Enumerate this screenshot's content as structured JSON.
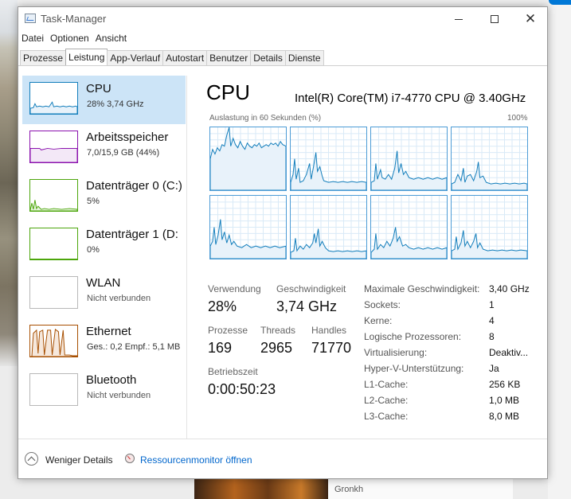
{
  "window": {
    "title": "Task-Manager"
  },
  "menu": [
    "Datei",
    "Optionen",
    "Ansicht"
  ],
  "tabs": [
    "Prozesse",
    "Leistung",
    "App-Verlauf",
    "Autostart",
    "Benutzer",
    "Details",
    "Dienste"
  ],
  "active_tab": "Leistung",
  "resources": [
    {
      "name": "CPU",
      "sub": "28%  3,74 GHz",
      "color": "#117dbb",
      "selected": true
    },
    {
      "name": "Arbeitsspeicher",
      "sub": "7,0/15,9 GB (44%)",
      "color": "#8b12ae",
      "selected": false
    },
    {
      "name": "Datenträger 0 (C:)",
      "sub": "5%",
      "color": "#4da60c",
      "selected": false
    },
    {
      "name": "Datenträger 1 (D:",
      "sub": "0%",
      "color": "#4da60c",
      "selected": false
    },
    {
      "name": "WLAN",
      "sub": "Nicht verbunden",
      "color": "#a0a0a0",
      "selected": false
    },
    {
      "name": "Ethernet",
      "sub": "Ges.: 0,2  Empf.: 5,1 MB",
      "color": "#a74f01",
      "selected": false
    },
    {
      "name": "Bluetooth",
      "sub": "Nicht verbunden",
      "color": "#a0a0a0",
      "selected": false
    }
  ],
  "cpu": {
    "title": "CPU",
    "model": "Intel(R) Core(TM) i7-4770 CPU @ 3.40GHz",
    "util_label": "Auslastung in 60 Sekunden (%)",
    "util_max": "100%",
    "stats": {
      "verwendung_label": "Verwendung",
      "verwendung": "28%",
      "geschwindigkeit_label": "Geschwindigkeit",
      "geschwindigkeit": "3,74 GHz",
      "prozesse_label": "Prozesse",
      "prozesse": "169",
      "threads_label": "Threads",
      "threads": "2965",
      "handles_label": "Handles",
      "handles": "71770",
      "betriebszeit_label": "Betriebszeit",
      "betriebszeit": "0:00:50:23"
    },
    "info": [
      {
        "key": "Maximale Geschwindigkeit:",
        "value": "3,40 GHz"
      },
      {
        "key": "Sockets:",
        "value": "1"
      },
      {
        "key": "Kerne:",
        "value": "4"
      },
      {
        "key": "Logische Prozessoren:",
        "value": "8"
      },
      {
        "key": "Virtualisierung:",
        "value": "Deaktiv..."
      },
      {
        "key": "Hyper-V-Unterstützung:",
        "value": "Ja"
      },
      {
        "key": "L1-Cache:",
        "value": "256 KB"
      },
      {
        "key": "L2-Cache:",
        "value": "1,0 MB"
      },
      {
        "key": "L3-Cache:",
        "value": "8,0 MB"
      }
    ]
  },
  "footer": {
    "fewer_details": "Weniger Details",
    "resource_monitor": "Ressourcenmonitor öffnen"
  },
  "background": {
    "card_title": "...",
    "card_sub": "Gronkh"
  },
  "colors": {
    "cpu_line": "#117dbb",
    "cpu_grid": "#d9eaf7",
    "selection": "#cce4f7",
    "link": "#0066cc"
  }
}
